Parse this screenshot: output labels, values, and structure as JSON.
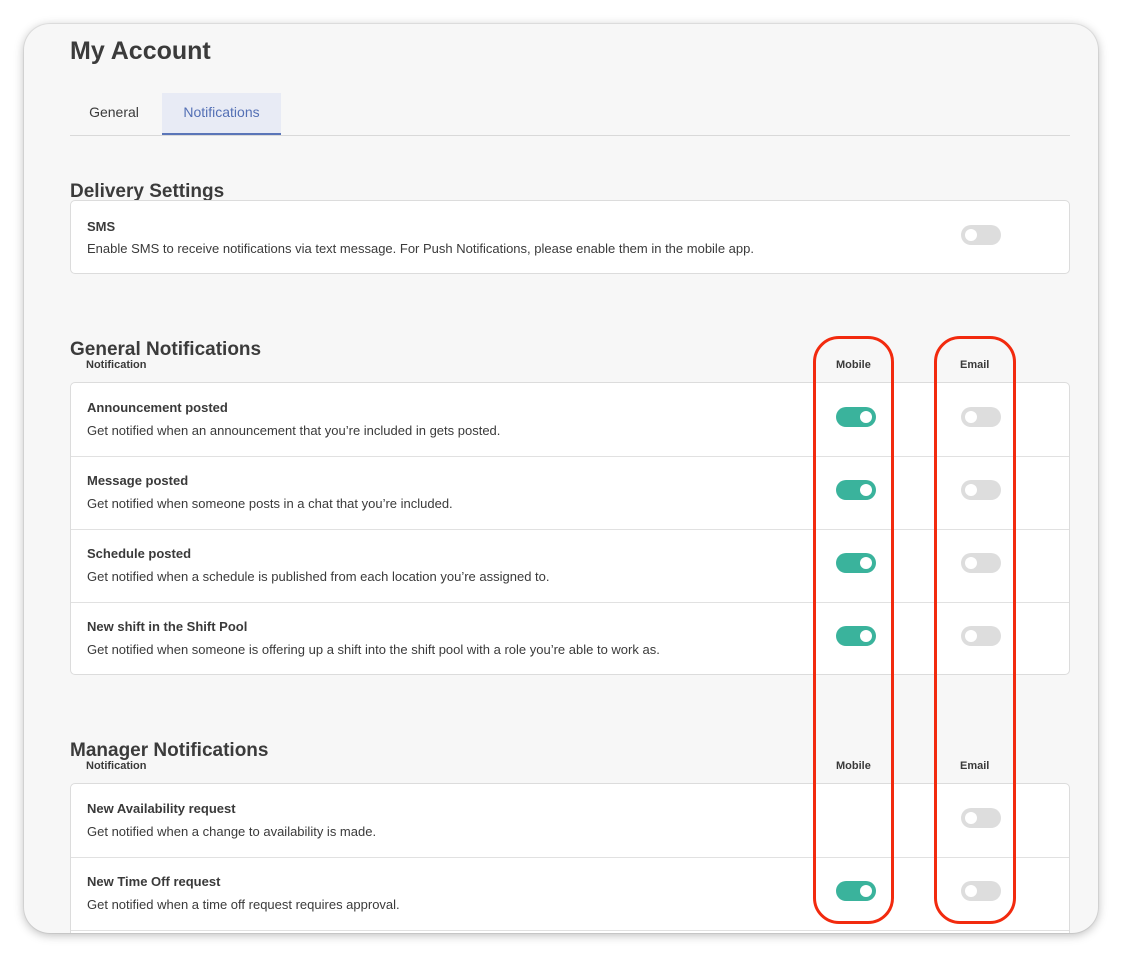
{
  "page": {
    "title": "My Account"
  },
  "tabs": [
    {
      "label": "General",
      "active": false
    },
    {
      "label": "Notifications",
      "active": true
    }
  ],
  "delivery": {
    "title": "Delivery Settings",
    "sms": {
      "title": "SMS",
      "description": "Enable SMS to receive notifications via text message. For Push Notifications, please enable them in the mobile app.",
      "enabled": false
    }
  },
  "general": {
    "title": "General Notifications",
    "columns": {
      "notification": "Notification",
      "mobile": "Mobile",
      "email": "Email"
    },
    "rows": [
      {
        "title": "Announcement posted",
        "description": "Get notified when an announcement that you’re included in gets posted.",
        "mobile": true,
        "email": false
      },
      {
        "title": "Message posted",
        "description": "Get notified when someone posts in a chat that you’re included.",
        "mobile": true,
        "email": false
      },
      {
        "title": "Schedule posted",
        "description": "Get notified when a schedule is published from each location you’re assigned to.",
        "mobile": true,
        "email": false
      },
      {
        "title": "New shift in the Shift Pool",
        "description": "Get notified when someone is offering up a shift into the shift pool with a role you’re able to work as.",
        "mobile": true,
        "email": false
      }
    ]
  },
  "manager": {
    "title": "Manager Notifications",
    "columns": {
      "notification": "Notification",
      "mobile": "Mobile",
      "email": "Email"
    },
    "rows": [
      {
        "title": "New Availability request",
        "description": "Get notified when a change to availability is made.",
        "mobile": null,
        "email": false
      },
      {
        "title": "New Time Off request",
        "description": "Get notified when a time off request requires approval.",
        "mobile": true,
        "email": false
      }
    ]
  },
  "colors": {
    "toggle_on": "#3ab39c",
    "toggle_off": "#dddddd",
    "tab_active": "#5470b5",
    "annotation": "#f22a0e"
  }
}
